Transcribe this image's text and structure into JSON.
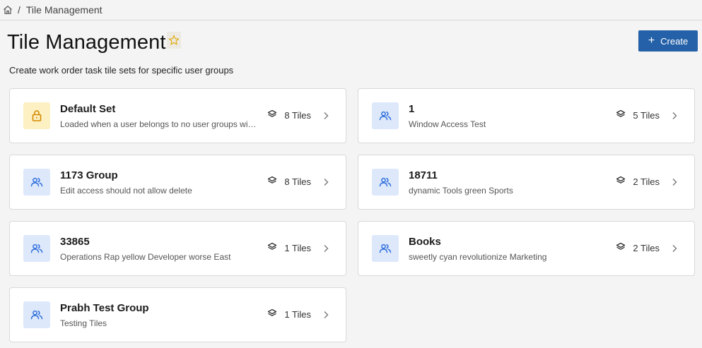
{
  "breadcrumb": {
    "current": "Tile Management",
    "separator": "/"
  },
  "header": {
    "title": "Tile Management",
    "create_label": "Create"
  },
  "subtitle": "Create work order task tile sets for specific user groups",
  "colors": {
    "accent": "#2461a8",
    "group_icon": "#2f6fdc",
    "lock_icon": "#d48a00"
  },
  "cards": [
    {
      "name": "Default Set",
      "description": "Loaded when a user belongs to no user groups with …",
      "tiles": "8 Tiles",
      "icon": "lock-icon"
    },
    {
      "name": "1",
      "description": "Window Access Test",
      "tiles": "5 Tiles",
      "icon": "user-group-icon"
    },
    {
      "name": "1173 Group",
      "description": "Edit access should not allow delete",
      "tiles": "8 Tiles",
      "icon": "user-group-icon"
    },
    {
      "name": "18711",
      "description": "dynamic Tools green Sports",
      "tiles": "2 Tiles",
      "icon": "user-group-icon"
    },
    {
      "name": "33865",
      "description": "Operations Rap yellow Developer worse East",
      "tiles": "1 Tiles",
      "icon": "user-group-icon"
    },
    {
      "name": "Books",
      "description": "sweetly cyan revolutionize Marketing",
      "tiles": "2 Tiles",
      "icon": "user-group-icon"
    },
    {
      "name": "Prabh Test Group",
      "description": "Testing Tiles",
      "tiles": "1 Tiles",
      "icon": "user-group-icon"
    }
  ]
}
